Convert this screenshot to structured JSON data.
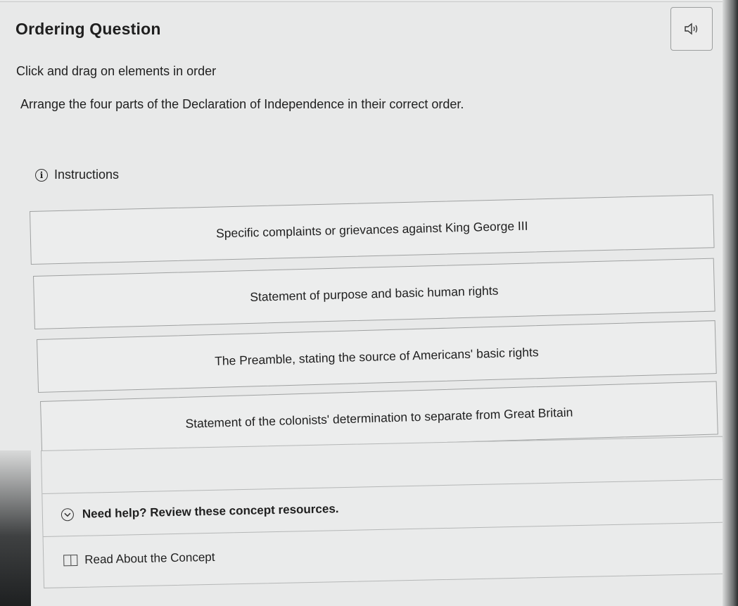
{
  "question": {
    "title": "Ordering Question",
    "subtitle": "Click and drag on elements in order",
    "prompt": "Arrange the four parts of the Declaration of Independence in their correct order.",
    "instructions_label": "Instructions",
    "audio_icon": "speaker-icon",
    "info_icon": "info-icon"
  },
  "items": [
    {
      "label": "Specific complaints or grievances against King George III"
    },
    {
      "label": "Statement of purpose and basic human rights"
    },
    {
      "label": "The Preamble, stating the source of Americans' basic rights"
    },
    {
      "label": "Statement of the colonists' determination to separate from Great Britain"
    }
  ],
  "help": {
    "toggle_label": "Need help? Review these concept resources.",
    "toggle_icon": "chevron-down-circle-icon",
    "resource_label": "Read About the Concept",
    "resource_icon": "book-icon"
  }
}
